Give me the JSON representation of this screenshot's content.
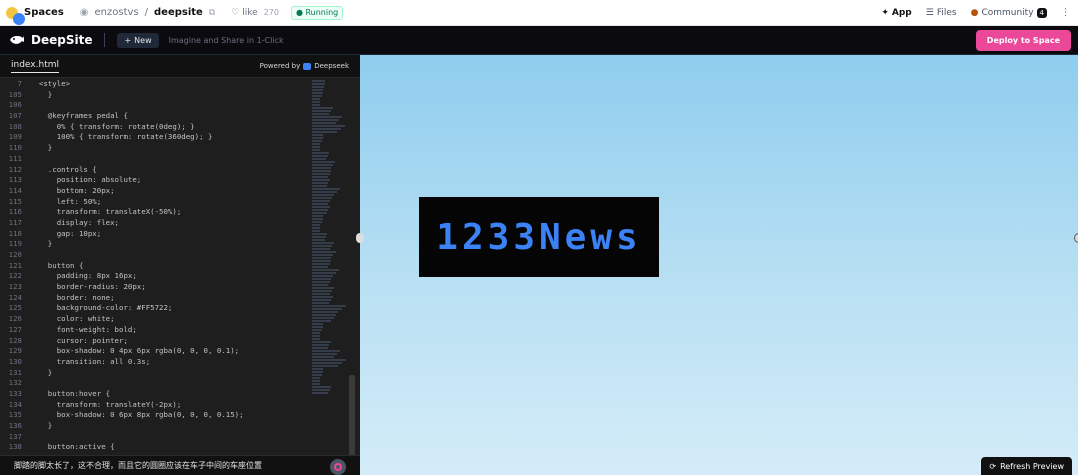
{
  "hf_bar": {
    "spaces_label": "Spaces",
    "owner": "enzostvs",
    "separator": "/",
    "repo": "deepsite",
    "like_label": "like",
    "like_count": "270",
    "status": "Running",
    "tabs": [
      {
        "label": "App",
        "icon": "app-icon"
      },
      {
        "label": "Files",
        "icon": "files-icon"
      },
      {
        "label": "Community",
        "icon": "community-icon",
        "count": "4"
      }
    ],
    "more": "⋮"
  },
  "header": {
    "brand": "DeepSite",
    "new_label": "New",
    "tagline": "Imagine and Share in 1-Click",
    "deploy_label": "Deploy to Space"
  },
  "editor": {
    "tab": "index.html",
    "powered_by": "Powered by",
    "powered_brand": "Deepseek",
    "lines": [
      {
        "n": "7",
        "code": "  <style>"
      },
      {
        "n": "105",
        "code": "    }"
      },
      {
        "n": "106",
        "code": ""
      },
      {
        "n": "107",
        "code": "    @keyframes pedal {"
      },
      {
        "n": "108",
        "code": "      0% { transform: rotate(0deg); }"
      },
      {
        "n": "109",
        "code": "      100% { transform: rotate(360deg); }"
      },
      {
        "n": "110",
        "code": "    }"
      },
      {
        "n": "111",
        "code": ""
      },
      {
        "n": "112",
        "code": "    .controls {"
      },
      {
        "n": "113",
        "code": "      position: absolute;"
      },
      {
        "n": "114",
        "code": "      bottom: 20px;"
      },
      {
        "n": "115",
        "code": "      left: 50%;"
      },
      {
        "n": "116",
        "code": "      transform: translateX(-50%);"
      },
      {
        "n": "117",
        "code": "      display: flex;"
      },
      {
        "n": "118",
        "code": "      gap: 10px;"
      },
      {
        "n": "119",
        "code": "    }"
      },
      {
        "n": "120",
        "code": ""
      },
      {
        "n": "121",
        "code": "    button {"
      },
      {
        "n": "122",
        "code": "      padding: 8px 16px;"
      },
      {
        "n": "123",
        "code": "      border-radius: 20px;"
      },
      {
        "n": "124",
        "code": "      border: none;"
      },
      {
        "n": "125",
        "code": "      background-color: #FF5722;"
      },
      {
        "n": "126",
        "code": "      color: white;"
      },
      {
        "n": "127",
        "code": "      font-weight: bold;"
      },
      {
        "n": "128",
        "code": "      cursor: pointer;"
      },
      {
        "n": "129",
        "code": "      box-shadow: 0 4px 6px rgba(0, 0, 0, 0.1);"
      },
      {
        "n": "130",
        "code": "      transition: all 0.3s;"
      },
      {
        "n": "131",
        "code": "    }"
      },
      {
        "n": "132",
        "code": ""
      },
      {
        "n": "133",
        "code": "    button:hover {"
      },
      {
        "n": "134",
        "code": "      transform: translateY(-2px);"
      },
      {
        "n": "135",
        "code": "      box-shadow: 0 6px 8px rgba(0, 0, 0, 0.15);"
      },
      {
        "n": "136",
        "code": "    }"
      },
      {
        "n": "137",
        "code": ""
      },
      {
        "n": "138",
        "code": "    button:active {"
      }
    ]
  },
  "chat": {
    "prompt": "脚踏的脚太长了，这不合理，而且它的圆圈应该在车子中间的车座位置"
  },
  "preview": {
    "news_text": "1233News",
    "refresh_label": "Refresh Preview"
  },
  "colors": {
    "accent_pink": "#ec4899",
    "news_blue": "#3b82f6",
    "editor_bg": "#1e1e1e"
  }
}
